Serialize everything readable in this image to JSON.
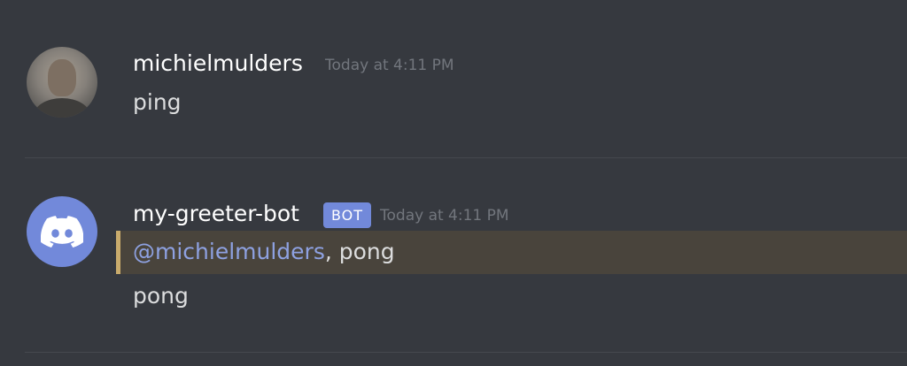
{
  "messages": [
    {
      "author": "michielmulders",
      "timestamp": "Today at 4:11 PM",
      "avatar_icon": "user-photo-avatar",
      "lines": [
        "ping"
      ]
    },
    {
      "author": "my-greeter-bot",
      "badge": "BOT",
      "timestamp": "Today at 4:11 PM",
      "avatar_icon": "discord-logo-icon",
      "mention_line": {
        "mention": "@michielmulders",
        "text": ", pong"
      },
      "lines": [
        "pong"
      ]
    }
  ],
  "colors": {
    "background": "#36393f",
    "blurple": "#7289da",
    "mention_highlight": "#49443c",
    "mention_border": "#c9ab6c",
    "mention_text": "#8ea1e1",
    "timestamp": "#72767d"
  }
}
